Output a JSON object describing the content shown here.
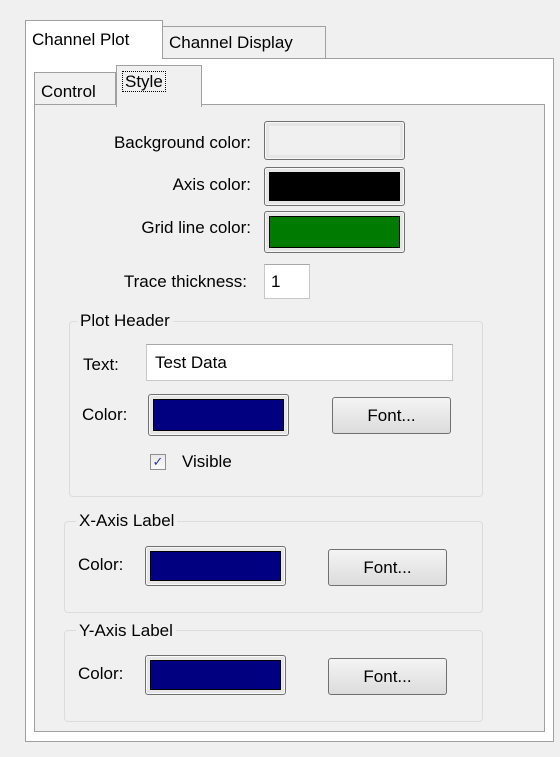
{
  "tabs": {
    "outer": [
      {
        "label": "Channel Plot",
        "active": true
      },
      {
        "label": "Channel Display",
        "active": false
      }
    ],
    "inner": [
      {
        "label": "Control",
        "active": false
      },
      {
        "label": "Style",
        "active": true
      }
    ]
  },
  "style": {
    "background_color_label": "Background color:",
    "background_color": "#f0f0f0",
    "axis_color_label": "Axis color:",
    "axis_color": "#000000",
    "grid_line_color_label": "Grid line color:",
    "grid_line_color": "#007a00",
    "trace_thickness_label": "Trace thickness:",
    "trace_thickness": "1"
  },
  "plot_header": {
    "title": "Plot Header",
    "text_label": "Text:",
    "text_value": "Test Data",
    "color_label": "Color:",
    "color": "#000080",
    "font_button": "Font...",
    "visible_label": "Visible",
    "visible_checked": true
  },
  "x_axis_label": {
    "title": "X-Axis Label",
    "color_label": "Color:",
    "color": "#000080",
    "font_button": "Font..."
  },
  "y_axis_label": {
    "title": "Y-Axis Label",
    "color_label": "Color:",
    "color": "#000080",
    "font_button": "Font..."
  }
}
